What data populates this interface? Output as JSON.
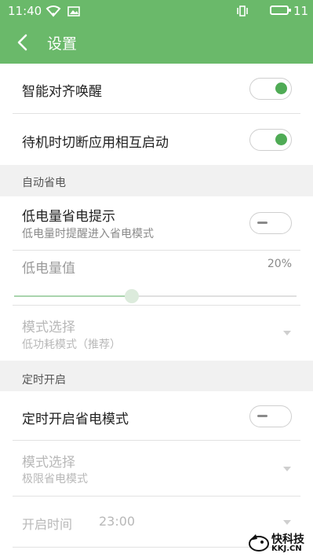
{
  "status_bar": {
    "time": "11:40",
    "battery_level": "11"
  },
  "header": {
    "title": "设置"
  },
  "settings": {
    "smart_align_wake": {
      "label": "智能对齐唤醒",
      "enabled": true
    },
    "standby_cut_app_launch": {
      "label": "待机时切断应用相互启动",
      "enabled": true
    }
  },
  "auto_power_saving": {
    "section_title": "自动省电",
    "low_battery_prompt": {
      "label": "低电量省电提示",
      "description": "低电量时提醒进入省电模式",
      "enabled": false
    },
    "low_battery_value": {
      "label": "低电量值",
      "value": "20%",
      "slider_fraction": 0.4
    },
    "mode_select": {
      "label": "模式选择",
      "value": "低功耗模式（推荐）"
    }
  },
  "scheduled_on": {
    "section_title": "定时开启",
    "scheduled_power_saving": {
      "label": "定时开启省电模式",
      "enabled": false
    },
    "mode_select": {
      "label": "模式选择",
      "value": "极限省电模式"
    },
    "start_time": {
      "label": "开启时间",
      "value": "23:00"
    }
  },
  "watermark": {
    "line1": "快科技",
    "line2": "KKJ.CN"
  },
  "colors": {
    "accent": "#6ab96a",
    "toggle_on": "#4fab55"
  }
}
